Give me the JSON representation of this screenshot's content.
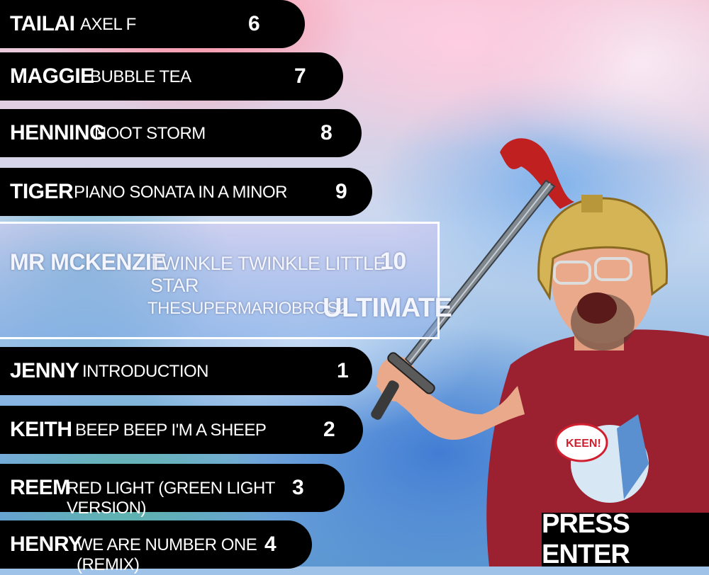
{
  "songs_above": [
    {
      "player": "TAILAI",
      "song": "AXEL F",
      "level": "6"
    },
    {
      "player": "MAGGIE",
      "song": "BUBBLE TEA",
      "level": "7"
    },
    {
      "player": "HENNING",
      "song": "NOOT STORM",
      "level": "8"
    },
    {
      "player": "TIGER",
      "song": "PIANO SONATA IN A MINOR",
      "level": "9"
    }
  ],
  "selected": {
    "player": "MR MCKENZIE",
    "song": "TWINKLE TWINKLE LITTLE STAR",
    "level": "10",
    "artist": "THESUPERMARIOBROS2",
    "difficulty": "ULTIMATE"
  },
  "songs_below": [
    {
      "player": "JENNY",
      "song": "INTRODUCTION",
      "level": "1"
    },
    {
      "player": "KEITH",
      "song": "BEEP BEEP I'M A SHEEP",
      "level": "2"
    },
    {
      "player": "REEM",
      "song": "RED LIGHT (GREEN LIGHT VERSION)",
      "level": "3"
    },
    {
      "player": "HENRY",
      "song": "WE ARE NUMBER ONE (REMIX)",
      "level": "4"
    }
  ],
  "press_enter": "PRESS ENTER",
  "colors": {
    "row_bg": "#000000",
    "text": "#ffffff",
    "selected_border": "#ffffff",
    "shirt": "#9b2030",
    "helmet": "#d4b455"
  }
}
